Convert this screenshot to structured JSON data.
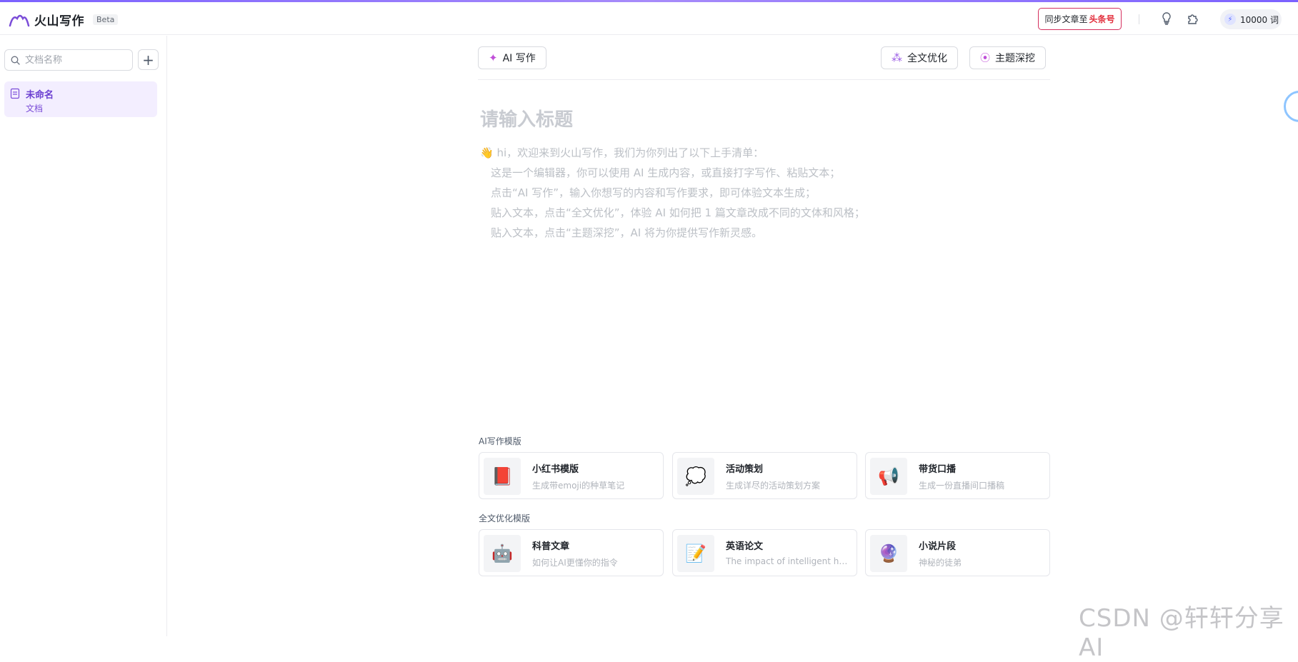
{
  "header": {
    "brand_name": "火山写作",
    "beta_label": "Beta",
    "sync_prefix": "同步文章至",
    "sync_target": "头条号",
    "quota_text": "10000 词"
  },
  "sidebar": {
    "search_placeholder": "文档名称",
    "doc_title": "未命名",
    "doc_type": "文档"
  },
  "toolbar": {
    "ai_write": "AI 写作",
    "full_optimize": "全文优化",
    "topic_dig": "主题深挖"
  },
  "editor": {
    "title_placeholder": "请输入标题",
    "hint_emoji": "👋",
    "hint_lines": [
      "hi，欢迎来到火山写作，我们为你列出了以下上手清单：",
      "这是一个编辑器，你可以使用 AI 生成内容，或直接打字写作、粘贴文本；",
      "点击“AI 写作”，输入你想写的内容和写作要求，即可体验文本生成；",
      "贴入文本，点击“全文优化”，体验 AI 如何把 1 篇文章改成不同的文体和风格；",
      "贴入文本，点击“主题深挖”，AI 将为你提供写作新灵感。"
    ]
  },
  "templates": {
    "ai_section_label": "AI写作模版",
    "ai_items": [
      {
        "icon": "📕",
        "icon_name": "red-book-icon",
        "name": "小红书模版",
        "desc": "生成带emoji的种草笔记"
      },
      {
        "icon": "💭",
        "icon_name": "thought-bubble-icon",
        "name": "活动策划",
        "desc": "生成详尽的活动策划方案"
      },
      {
        "icon": "📢",
        "icon_name": "megaphone-icon",
        "name": "带货口播",
        "desc": "生成一份直播间口播稿"
      }
    ],
    "opt_section_label": "全文优化模版",
    "opt_items": [
      {
        "icon": "🤖",
        "icon_name": "robot-icon",
        "name": "科普文章",
        "desc": "如何让AI更懂你的指令"
      },
      {
        "icon": "📝",
        "icon_name": "memo-icon",
        "name": "英语论文",
        "desc": "The impact of intelligent hou…"
      },
      {
        "icon": "🔮",
        "icon_name": "crystal-ball-icon",
        "name": "小说片段",
        "desc": "神秘的徒弟"
      }
    ]
  },
  "watermark": "CSDN @轩轩分享AI",
  "colors": {
    "accent": "#7b4dd8",
    "brand_red": "#e22c3a",
    "hint_text": "#bcc0c6"
  }
}
